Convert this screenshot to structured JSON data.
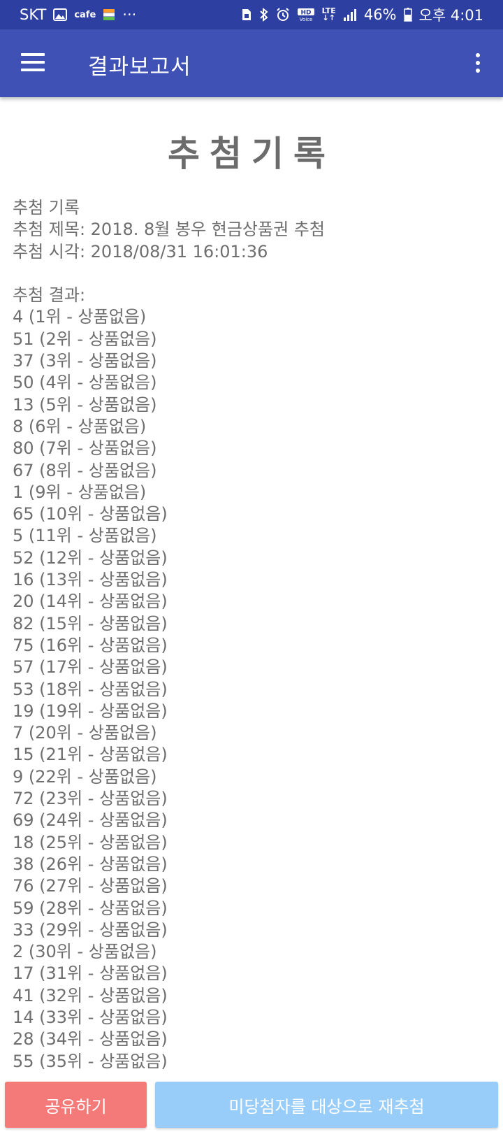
{
  "status_bar": {
    "carrier": "SKT",
    "cafe": "cafe",
    "more": "···",
    "lte": "LTE",
    "battery": "46%",
    "time": "오후 4:01"
  },
  "app_bar": {
    "title": "결과보고서"
  },
  "report": {
    "heading": "추첨기록",
    "lines": [
      "추첨 기록",
      "추첨 제목: 2018. 8월 봉우 현금상품권 추첨",
      "추첨 시각: 2018/08/31 16:01:36",
      "",
      "추첨 결과:",
      "4 (1위 - 상품없음)",
      "51 (2위 - 상품없음)",
      "37 (3위 - 상품없음)",
      "50 (4위 - 상품없음)",
      "13 (5위 - 상품없음)",
      "8 (6위 - 상품없음)",
      "80 (7위 - 상품없음)",
      "67 (8위 - 상품없음)",
      "1 (9위 - 상품없음)",
      "65 (10위 - 상품없음)",
      "5 (11위 - 상품없음)",
      "52 (12위 - 상품없음)",
      "16 (13위 - 상품없음)",
      "20 (14위 - 상품없음)",
      "82 (15위 - 상품없음)",
      "75 (16위 - 상품없음)",
      "57 (17위 - 상품없음)",
      "53 (18위 - 상품없음)",
      "19 (19위 - 상품없음)",
      "7 (20위 - 상품없음)",
      "15 (21위 - 상품없음)",
      "9 (22위 - 상품없음)",
      "72 (23위 - 상품없음)",
      "69 (24위 - 상품없음)",
      "18 (25위 - 상품없음)",
      "38 (26위 - 상품없음)",
      "76 (27위 - 상품없음)",
      "59 (28위 - 상품없음)",
      "33 (29위 - 상품없음)",
      "2 (30위 - 상품없음)",
      "17 (31위 - 상품없음)",
      "41 (32위 - 상품없음)",
      "14 (33위 - 상품없음)",
      "28 (34위 - 상품없음)",
      "55 (35위 - 상품없음)"
    ]
  },
  "buttons": {
    "share": "공유하기",
    "redraw": "미당첨자를 대상으로 재추첨"
  },
  "colors": {
    "status_bar": "#2d3fa0",
    "app_bar": "#3f51b5",
    "share_button": "#f47a7a",
    "redraw_button": "#99cdf9",
    "text": "#6e6e6e"
  }
}
